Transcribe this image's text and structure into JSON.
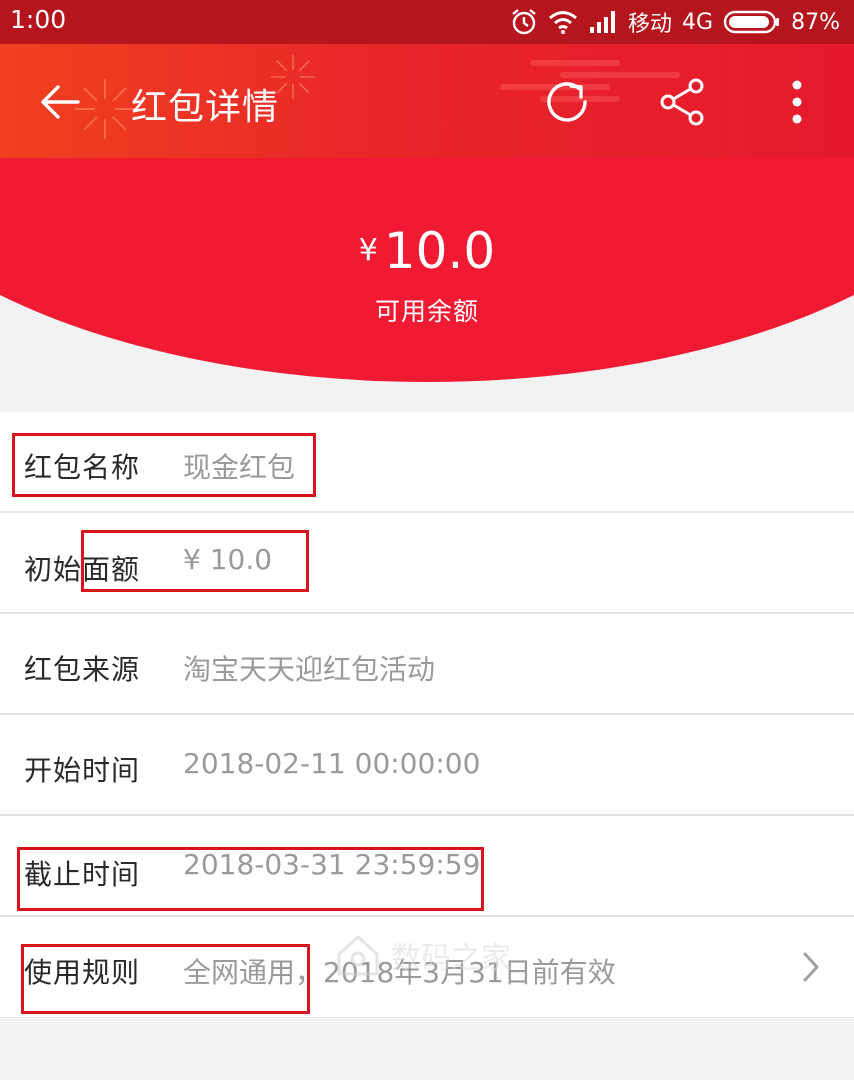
{
  "status_bar": {
    "time": "1:00",
    "carrier": "移动",
    "network": "4G",
    "battery": "87%",
    "icons": [
      "alarm-icon",
      "wifi-icon",
      "signal-icon",
      "battery-icon"
    ]
  },
  "app_bar": {
    "title": "红包详情",
    "back_icon": "arrow-left-icon",
    "refresh_icon": "refresh-icon",
    "share_icon": "share-icon",
    "more_icon": "more-vertical-icon"
  },
  "hero": {
    "currency": "¥",
    "amount": "10.0",
    "caption": "可用余额"
  },
  "details": [
    {
      "label": "红包名称",
      "value": "现金红包"
    },
    {
      "label": "初始面额",
      "value": "¥ 10.0"
    },
    {
      "label": "红包来源",
      "value": "淘宝天天迎红包活动"
    },
    {
      "label": "开始时间",
      "value": "2018-02-11 00:00:00"
    },
    {
      "label": "截止时间",
      "value": "2018-03-31 23:59:59"
    },
    {
      "label": "使用规则",
      "value": "全网通用，2018年3月31日前有效"
    }
  ],
  "watermark": {
    "text": "数码之家"
  },
  "colors": {
    "status_bar": "#b5151c",
    "app_bar_start": "#f0401f",
    "app_bar_end": "#e41a2c",
    "hero_red": "#f11a33",
    "highlight_box": "#d9141c",
    "label_text": "#2a2a2a",
    "value_text": "#9a9a9a"
  }
}
